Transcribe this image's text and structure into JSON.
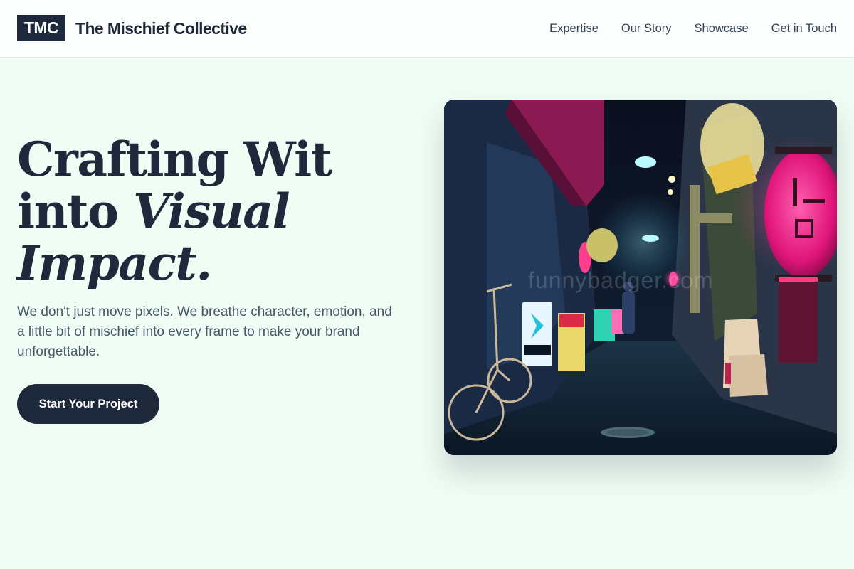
{
  "header": {
    "logo_text": "TMC",
    "brand_name": "The Mischief Collective",
    "nav": [
      {
        "label": "Expertise"
      },
      {
        "label": "Our Story"
      },
      {
        "label": "Showcase"
      },
      {
        "label": "Get in Touch"
      }
    ]
  },
  "hero": {
    "title_line1": "Crafting Wit",
    "title_line2_plain": "into ",
    "title_line2_italic": "Visual",
    "title_line3_italic": "Impact.",
    "subtitle": "We don't just move pixels. We breathe character, emotion, and a little bit of mischief into every frame to make your brand unforgettable.",
    "cta_label": "Start Your Project",
    "image": {
      "subject": "neon-lit night alley photo",
      "watermark": "funnybadger.com"
    }
  },
  "colors": {
    "page_bg": "#effdf4",
    "header_bg": "#fbfefc",
    "primary": "#1e293b",
    "text_muted": "#475569"
  }
}
